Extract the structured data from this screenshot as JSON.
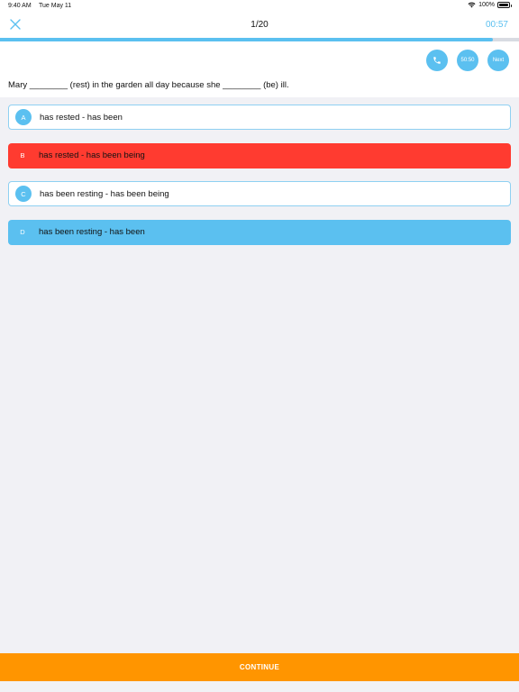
{
  "status": {
    "time": "9:40 AM",
    "date": "Tue May 11",
    "battery": "100%"
  },
  "nav": {
    "counter": "1/20",
    "timer": "00:57",
    "progress": 0.95,
    "accent_color": "#5bc0f0"
  },
  "help": {
    "call_icon": "phone-icon",
    "fifty_label": "50:50",
    "next_label": "Next"
  },
  "question": {
    "text": "Mary ________ (rest) in the garden all day because she ________ (be) ill."
  },
  "options": [
    {
      "letter": "A",
      "text": "has rested - has been",
      "state": "neutral"
    },
    {
      "letter": "B",
      "text": "has rested - has been being",
      "state": "wrong",
      "color": "#ff3b30"
    },
    {
      "letter": "C",
      "text": "has been resting - has been being",
      "state": "neutral"
    },
    {
      "letter": "D",
      "text": "has been resting - has been",
      "state": "correct",
      "color": "#5bc0f0"
    }
  ],
  "continue": {
    "label": "CONTINUE",
    "color": "#ff9500"
  }
}
